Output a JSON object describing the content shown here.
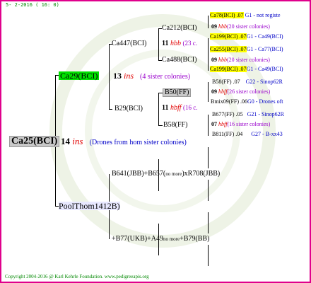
{
  "date": "5- 2-2016 ( 16: 0)",
  "footer": "Copyright 2004-2016 @ Karl Kehrle Foundation.   www.pedigreeapis.org",
  "root": {
    "name": "Ca25(BCI)",
    "num": "14",
    "ins": "ins",
    "note": "(Drones from hom sister colonies)"
  },
  "dam": {
    "name": "Ca29(BCI)",
    "num": "13",
    "ins": "ins",
    "note": "(4 sister colonies)"
  },
  "sire": {
    "name": "PoolThom1412B)"
  },
  "dd": {
    "name": "Ca447(BCI)",
    "num": "11",
    "sym": "hbb",
    "count": "(23 c."
  },
  "ds": {
    "name": "B29(BCI)",
    "num": "11",
    "sym": "hbff",
    "count": "(16 c."
  },
  "ddd": {
    "name": "Ca212(BCI)"
  },
  "dds": {
    "name": "Ca488(BCI)"
  },
  "dsd": {
    "name": "B50(FF)"
  },
  "dss": {
    "name": "B58(FF)"
  },
  "right": [
    {
      "a": "Ca78(BCI) .07",
      "b": "G1 - not registe"
    },
    {
      "a": "09",
      "sym": "hbb",
      "b": "(20 sister colonies)"
    },
    {
      "a": "Ca199(BCI) .07",
      "b": "G1 - Ca49(BCI)"
    },
    {
      "a": "Ca255(BCI) .07",
      "b": "G1 - Ca77(BCI)"
    },
    {
      "a": "09",
      "sym": "hbb",
      "b": "(20 sister colonies)"
    },
    {
      "a": "Ca199(BCI) .07",
      "b": "G1 - Ca49(BCI)"
    },
    {
      "a": "B58(FF) .07",
      "b": "G22 - Sinop62R"
    },
    {
      "a": "09",
      "sym": "hbff",
      "b": "(26 sister colonies)"
    },
    {
      "a": "Bmix09(FF) .06",
      "b": "G0 - Drones oft"
    },
    {
      "a": "B677(FF) .05",
      "b": "G21 - Sinop62R"
    },
    {
      "a": "07",
      "sym": "hbff",
      "b": "(16 sister colonies)"
    },
    {
      "a": "B811(FF) .04",
      "b": "G27 - B-xx43"
    }
  ],
  "sire_row1": {
    "left": "B641(JBB)+B657(",
    "mid": "no more",
    "right": ")xR708(JBB)"
  },
  "sire_row2": {
    "left": "+B77(UKB)+A49",
    "mid": "no more",
    "right": "+B79(BB)"
  }
}
